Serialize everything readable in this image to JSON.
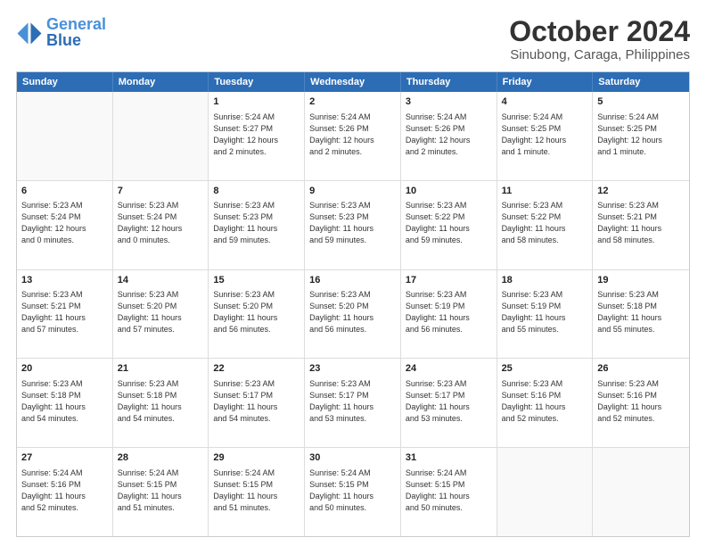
{
  "header": {
    "logo_line1": "General",
    "logo_line2": "Blue",
    "month": "October 2024",
    "location": "Sinubong, Caraga, Philippines"
  },
  "days": [
    "Sunday",
    "Monday",
    "Tuesday",
    "Wednesday",
    "Thursday",
    "Friday",
    "Saturday"
  ],
  "rows": [
    [
      {
        "day": "",
        "info": ""
      },
      {
        "day": "",
        "info": ""
      },
      {
        "day": "1",
        "info": "Sunrise: 5:24 AM\nSunset: 5:27 PM\nDaylight: 12 hours\nand 2 minutes."
      },
      {
        "day": "2",
        "info": "Sunrise: 5:24 AM\nSunset: 5:26 PM\nDaylight: 12 hours\nand 2 minutes."
      },
      {
        "day": "3",
        "info": "Sunrise: 5:24 AM\nSunset: 5:26 PM\nDaylight: 12 hours\nand 2 minutes."
      },
      {
        "day": "4",
        "info": "Sunrise: 5:24 AM\nSunset: 5:25 PM\nDaylight: 12 hours\nand 1 minute."
      },
      {
        "day": "5",
        "info": "Sunrise: 5:24 AM\nSunset: 5:25 PM\nDaylight: 12 hours\nand 1 minute."
      }
    ],
    [
      {
        "day": "6",
        "info": "Sunrise: 5:23 AM\nSunset: 5:24 PM\nDaylight: 12 hours\nand 0 minutes."
      },
      {
        "day": "7",
        "info": "Sunrise: 5:23 AM\nSunset: 5:24 PM\nDaylight: 12 hours\nand 0 minutes."
      },
      {
        "day": "8",
        "info": "Sunrise: 5:23 AM\nSunset: 5:23 PM\nDaylight: 11 hours\nand 59 minutes."
      },
      {
        "day": "9",
        "info": "Sunrise: 5:23 AM\nSunset: 5:23 PM\nDaylight: 11 hours\nand 59 minutes."
      },
      {
        "day": "10",
        "info": "Sunrise: 5:23 AM\nSunset: 5:22 PM\nDaylight: 11 hours\nand 59 minutes."
      },
      {
        "day": "11",
        "info": "Sunrise: 5:23 AM\nSunset: 5:22 PM\nDaylight: 11 hours\nand 58 minutes."
      },
      {
        "day": "12",
        "info": "Sunrise: 5:23 AM\nSunset: 5:21 PM\nDaylight: 11 hours\nand 58 minutes."
      }
    ],
    [
      {
        "day": "13",
        "info": "Sunrise: 5:23 AM\nSunset: 5:21 PM\nDaylight: 11 hours\nand 57 minutes."
      },
      {
        "day": "14",
        "info": "Sunrise: 5:23 AM\nSunset: 5:20 PM\nDaylight: 11 hours\nand 57 minutes."
      },
      {
        "day": "15",
        "info": "Sunrise: 5:23 AM\nSunset: 5:20 PM\nDaylight: 11 hours\nand 56 minutes."
      },
      {
        "day": "16",
        "info": "Sunrise: 5:23 AM\nSunset: 5:20 PM\nDaylight: 11 hours\nand 56 minutes."
      },
      {
        "day": "17",
        "info": "Sunrise: 5:23 AM\nSunset: 5:19 PM\nDaylight: 11 hours\nand 56 minutes."
      },
      {
        "day": "18",
        "info": "Sunrise: 5:23 AM\nSunset: 5:19 PM\nDaylight: 11 hours\nand 55 minutes."
      },
      {
        "day": "19",
        "info": "Sunrise: 5:23 AM\nSunset: 5:18 PM\nDaylight: 11 hours\nand 55 minutes."
      }
    ],
    [
      {
        "day": "20",
        "info": "Sunrise: 5:23 AM\nSunset: 5:18 PM\nDaylight: 11 hours\nand 54 minutes."
      },
      {
        "day": "21",
        "info": "Sunrise: 5:23 AM\nSunset: 5:18 PM\nDaylight: 11 hours\nand 54 minutes."
      },
      {
        "day": "22",
        "info": "Sunrise: 5:23 AM\nSunset: 5:17 PM\nDaylight: 11 hours\nand 54 minutes."
      },
      {
        "day": "23",
        "info": "Sunrise: 5:23 AM\nSunset: 5:17 PM\nDaylight: 11 hours\nand 53 minutes."
      },
      {
        "day": "24",
        "info": "Sunrise: 5:23 AM\nSunset: 5:17 PM\nDaylight: 11 hours\nand 53 minutes."
      },
      {
        "day": "25",
        "info": "Sunrise: 5:23 AM\nSunset: 5:16 PM\nDaylight: 11 hours\nand 52 minutes."
      },
      {
        "day": "26",
        "info": "Sunrise: 5:23 AM\nSunset: 5:16 PM\nDaylight: 11 hours\nand 52 minutes."
      }
    ],
    [
      {
        "day": "27",
        "info": "Sunrise: 5:24 AM\nSunset: 5:16 PM\nDaylight: 11 hours\nand 52 minutes."
      },
      {
        "day": "28",
        "info": "Sunrise: 5:24 AM\nSunset: 5:15 PM\nDaylight: 11 hours\nand 51 minutes."
      },
      {
        "day": "29",
        "info": "Sunrise: 5:24 AM\nSunset: 5:15 PM\nDaylight: 11 hours\nand 51 minutes."
      },
      {
        "day": "30",
        "info": "Sunrise: 5:24 AM\nSunset: 5:15 PM\nDaylight: 11 hours\nand 50 minutes."
      },
      {
        "day": "31",
        "info": "Sunrise: 5:24 AM\nSunset: 5:15 PM\nDaylight: 11 hours\nand 50 minutes."
      },
      {
        "day": "",
        "info": ""
      },
      {
        "day": "",
        "info": ""
      }
    ]
  ]
}
